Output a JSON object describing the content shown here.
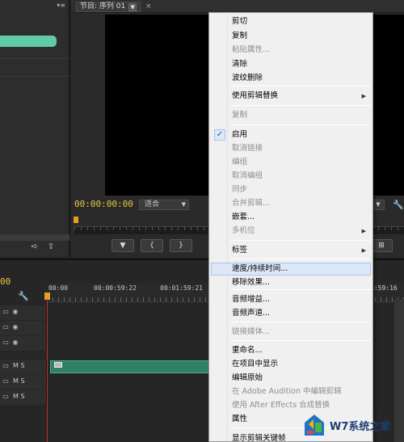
{
  "program_monitor": {
    "tab_label": "节目: 序列 01",
    "tab_dropdown": "▼",
    "tab_close": "×",
    "timecode": "00:00:00:00",
    "fit_label": "适合"
  },
  "timeline": {
    "current_timecode": "00",
    "ruler_labels": [
      "00:00",
      "00:00:59:22",
      "00:01:59:21"
    ],
    "right_timecode": "4:59:16",
    "tracks": [
      {
        "label": ""
      },
      {
        "label": ""
      },
      {
        "label": ""
      },
      {
        "label": "M  S"
      },
      {
        "label": "M  S"
      },
      {
        "label": "M  S"
      }
    ]
  },
  "context_menu": {
    "items": [
      {
        "label": "剪切",
        "disabled": false
      },
      {
        "label": "复制",
        "disabled": false
      },
      {
        "label": "粘贴属性...",
        "disabled": true
      },
      {
        "label": "清除",
        "disabled": false
      },
      {
        "label": "波纹删除",
        "disabled": false
      },
      {
        "label": "使用剪辑替换",
        "disabled": false,
        "submenu": true
      },
      {
        "label": "复制",
        "disabled": true
      },
      {
        "label": "启用",
        "disabled": false,
        "checked": true
      },
      {
        "label": "取消链接",
        "disabled": true
      },
      {
        "label": "编组",
        "disabled": true
      },
      {
        "label": "取消编组",
        "disabled": true
      },
      {
        "label": "同步",
        "disabled": true
      },
      {
        "label": "合并剪辑...",
        "disabled": true
      },
      {
        "label": "嵌套...",
        "disabled": false
      },
      {
        "label": "多机位",
        "disabled": true,
        "submenu": true
      },
      {
        "label": "标签",
        "disabled": false,
        "submenu": true
      },
      {
        "label": "速度/持续时间...",
        "disabled": false,
        "highlighted": true
      },
      {
        "label": "移除效果...",
        "disabled": false
      },
      {
        "label": "音频增益...",
        "disabled": false
      },
      {
        "label": "音频声道...",
        "disabled": false
      },
      {
        "label": "链接媒体...",
        "disabled": true
      },
      {
        "label": "重命名...",
        "disabled": false
      },
      {
        "label": "在项目中显示",
        "disabled": false
      },
      {
        "label": "编辑原始",
        "disabled": false
      },
      {
        "label": "在 Adobe Audition 中编辑剪辑",
        "disabled": true
      },
      {
        "label": "使用 After Effects 合成替换",
        "disabled": true
      },
      {
        "label": "属性",
        "disabled": false
      },
      {
        "label": "显示剪辑关键帧",
        "disabled": false
      }
    ],
    "submenu_arrow": "▶",
    "check_mark": "✓"
  },
  "watermark": {
    "text": "W7系统之家"
  },
  "icons": {
    "wrench": "wrench-icon",
    "eye": "eye-icon",
    "film": "film-icon",
    "marker": "marker-icon"
  }
}
